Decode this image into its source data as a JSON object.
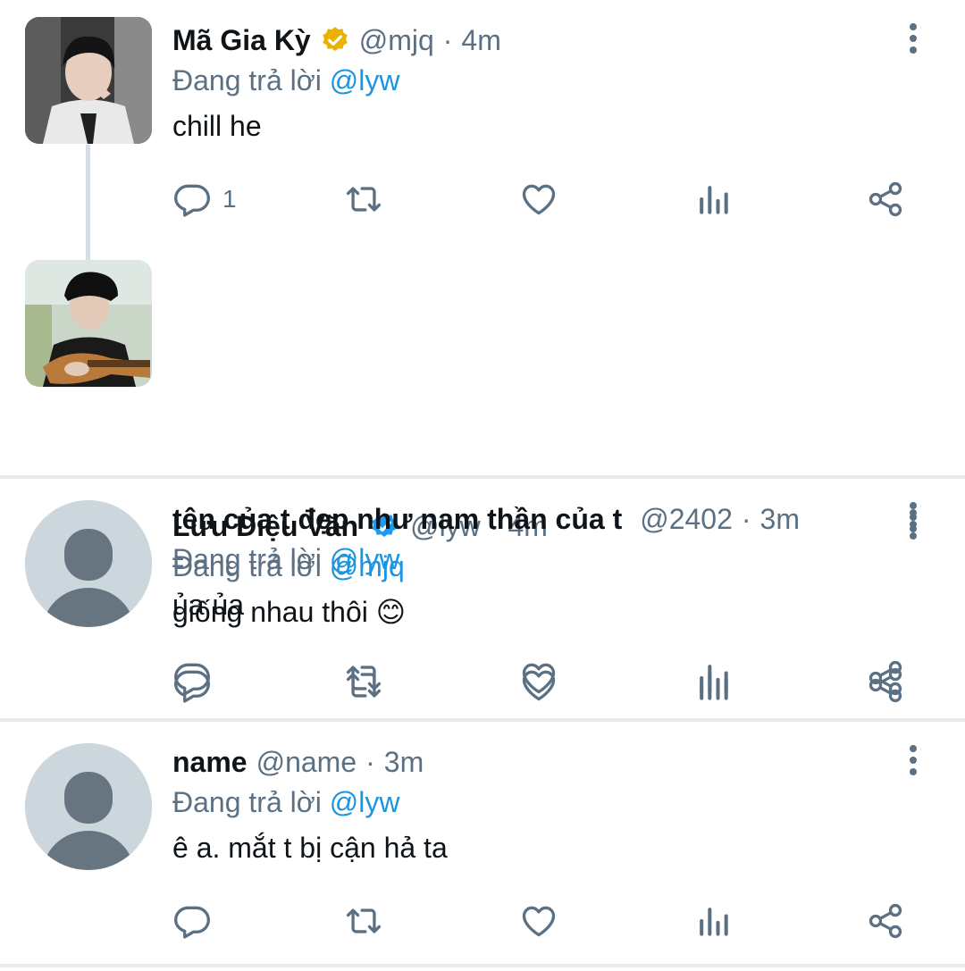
{
  "colors": {
    "name": "#0f1419",
    "secondary": "#5b7083",
    "mention": "#1b95e0",
    "gold_badge": "#e8b200",
    "blue_badge": "#1d9bf0",
    "divider": "#e6ecf0"
  },
  "reply_prefix": "Đang trả lời",
  "tweets": [
    {
      "name": "Mã Gia Kỳ",
      "badge": "gold-verified-icon",
      "handle": "@mjq",
      "time": "4m",
      "reply_to": "@lyw",
      "text": "chill he",
      "reply_count": "1"
    },
    {
      "name": "Lưu Diệu Văn",
      "badge": "blue-verified-icon",
      "handle": "@lyw",
      "time": "4m",
      "reply_to": "@mjq",
      "text": "giống nhau thôi 😊",
      "reply_count": ""
    },
    {
      "name": "tên của t đẹp như nam thần của t",
      "badge": "",
      "handle": "@2402",
      "time": "3m",
      "reply_to": "@lyw",
      "text": "ủa ủa",
      "reply_count": ""
    },
    {
      "name": "name",
      "badge": "",
      "handle": "@name",
      "time": "3m",
      "reply_to": "@lyw",
      "text": "ê a. mắt t bị cận hả ta",
      "reply_count": ""
    }
  ],
  "separator": "·"
}
